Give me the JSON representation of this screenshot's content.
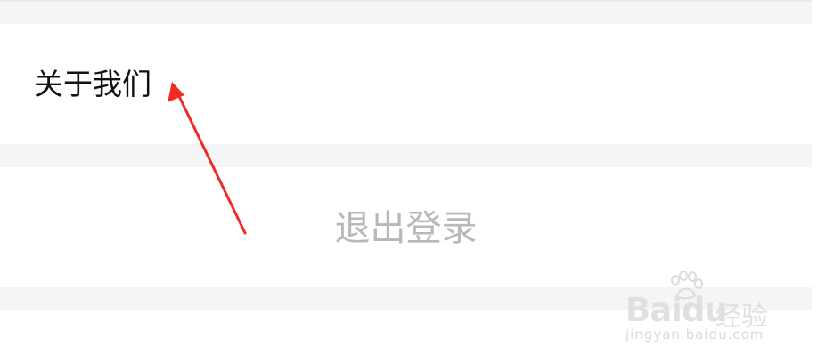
{
  "settings": {
    "about_label": "关于我们",
    "logout_label": "退出登录"
  },
  "annotation": {
    "arrow_color": "#ee2c24"
  },
  "watermark": {
    "brand": "Baidu",
    "product": "经验",
    "url": "jingyan.baidu.com"
  },
  "colors": {
    "page_background": "#f4f5f7",
    "row_background": "#ffffff",
    "about_text": "#111111",
    "logout_text": "#b8b8b8"
  }
}
